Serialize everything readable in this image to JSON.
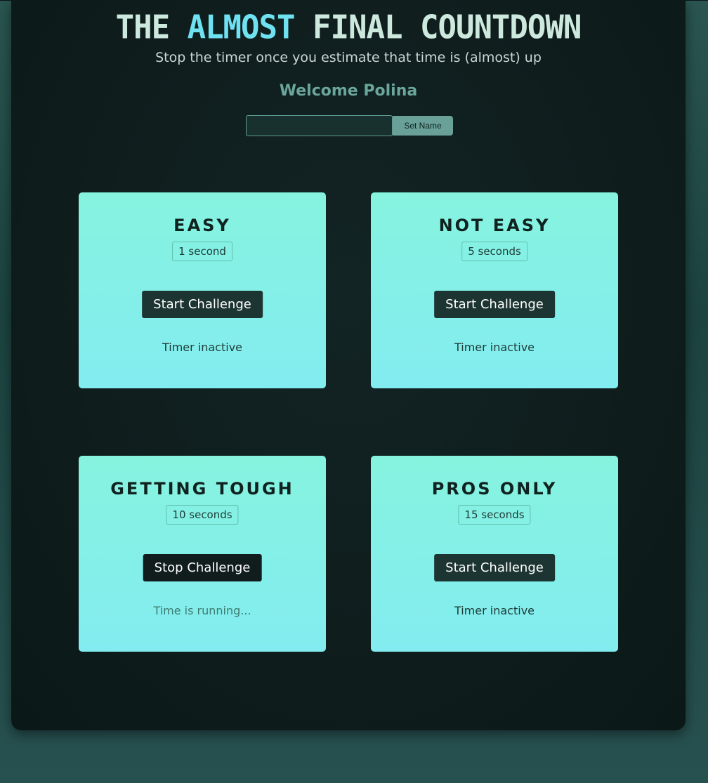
{
  "header": {
    "title_part1": "THE",
    "title_accent": "ALMOST",
    "title_part2": "FINAL COUNTDOWN",
    "subtitle": "Stop the timer once you estimate that time is (almost) up",
    "welcome": "Welcome Polina"
  },
  "name_form": {
    "input_value": "",
    "button_label": "Set Name"
  },
  "challenges": [
    {
      "title": "EASY",
      "duration": "1 second",
      "button_label": "Start Challenge",
      "status": "Timer inactive",
      "state": "inactive"
    },
    {
      "title": "NOT EASY",
      "duration": "5 seconds",
      "button_label": "Start Challenge",
      "status": "Timer inactive",
      "state": "inactive"
    },
    {
      "title": "GETTING TOUGH",
      "duration": "10 seconds",
      "button_label": "Stop Challenge",
      "status": "Time is running...",
      "state": "running"
    },
    {
      "title": "PROS ONLY",
      "duration": "15 seconds",
      "button_label": "Start Challenge",
      "status": "Timer inactive",
      "state": "inactive"
    }
  ],
  "colors": {
    "accent": "#6fe2f2",
    "title_text": "#cde9dd",
    "welcome_text": "#6aa69c",
    "card_top": "#86f3df",
    "card_bottom": "#83ecf0",
    "button_dark": "#1d3532",
    "panel_bg": "#0f1d1d"
  }
}
